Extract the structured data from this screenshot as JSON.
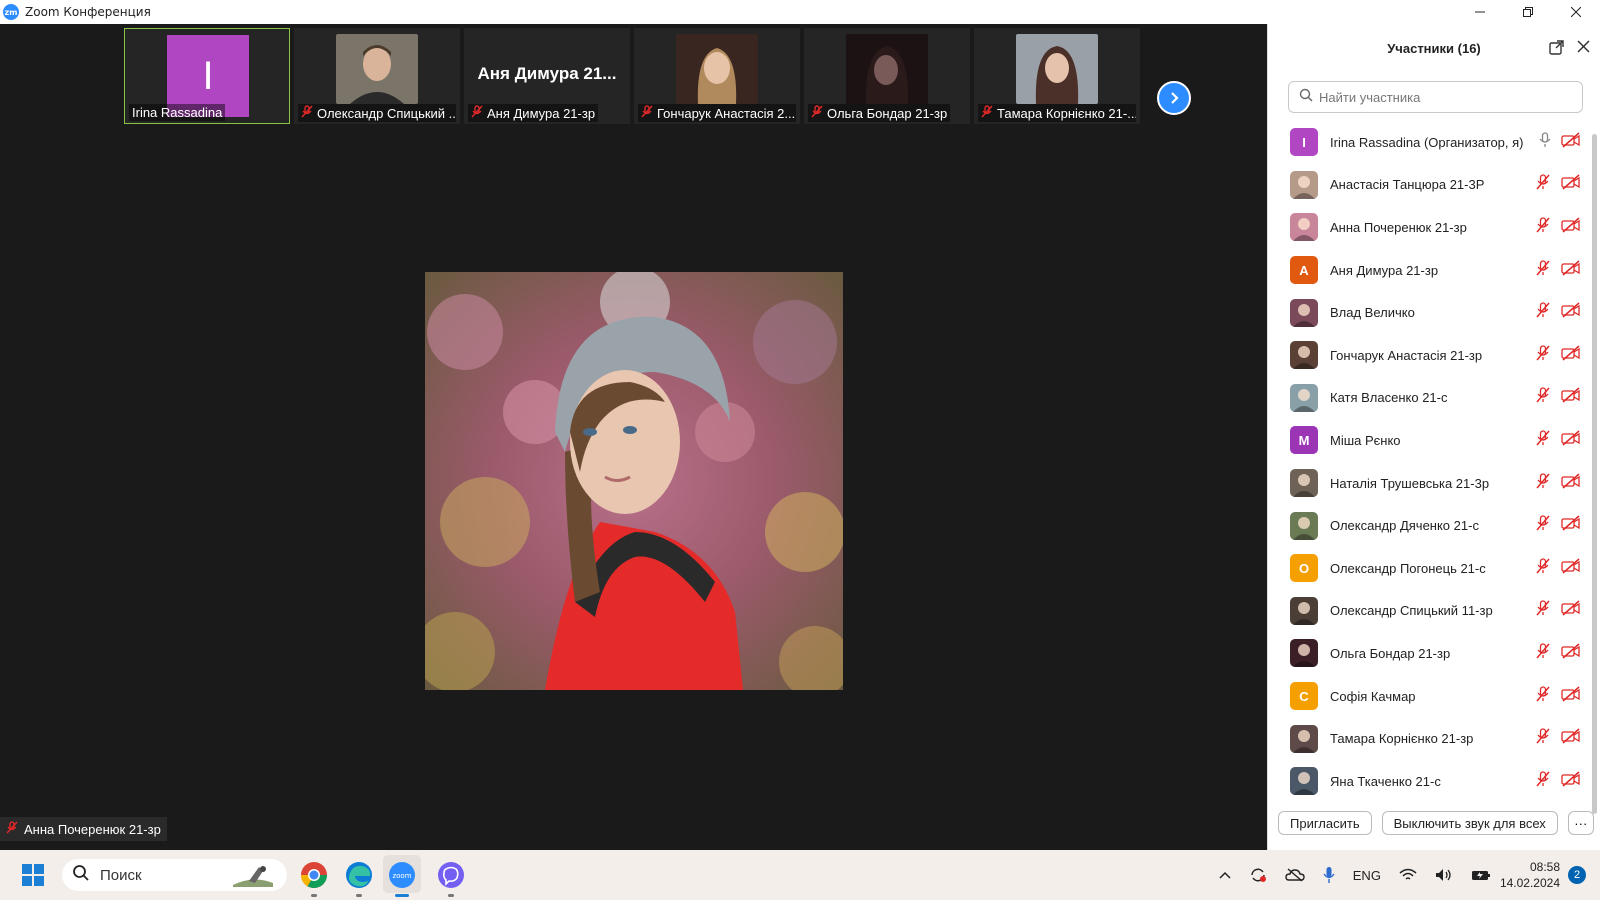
{
  "window": {
    "title": "Zoom Конференция",
    "logo": "zm"
  },
  "thumbnails": [
    {
      "name": "Irina Rassadina",
      "type": "letter",
      "letter": "I",
      "color": "#b146c2",
      "muted": false,
      "active": true
    },
    {
      "name": "Олександр Спицький ...",
      "type": "photo",
      "muted": true
    },
    {
      "name": "Аня Димура 21-зр",
      "type": "name",
      "big_name": "Аня Димура 21...",
      "muted": true
    },
    {
      "name": "Гончарук Анастасія 2...",
      "type": "photo",
      "muted": true
    },
    {
      "name": "Ольга Бондар 21-зр",
      "type": "photo",
      "muted": true
    },
    {
      "name": "Тамара Корнієнко 21-...",
      "type": "photo",
      "muted": true
    }
  ],
  "active_speaker": {
    "name": "Анна Почеренюк 21-зр",
    "muted": true
  },
  "panel": {
    "title": "Участники (16)",
    "search_placeholder": "Найти участника",
    "participants": [
      {
        "name": "Irina Rassadina (Организатор, я)",
        "avatar": "letter",
        "letter": "I",
        "color": "#b146c2",
        "mic_muted": false,
        "video_off": true
      },
      {
        "name": "Анастасія Танцюра 21-3Р",
        "avatar": "photo",
        "color": "#b59a8a",
        "mic_muted": true,
        "video_off": true
      },
      {
        "name": "Анна Почеренюк 21-зр",
        "avatar": "photo",
        "color": "#c9869b",
        "mic_muted": true,
        "video_off": true
      },
      {
        "name": "Аня Димура 21-зр",
        "avatar": "letter",
        "letter": "A",
        "color": "#e1590f",
        "mic_muted": true,
        "video_off": true
      },
      {
        "name": "Влад Величко",
        "avatar": "photo",
        "color": "#7a4a5a",
        "mic_muted": true,
        "video_off": true
      },
      {
        "name": "Гончарук Анастасія 21-зр",
        "avatar": "photo",
        "color": "#5a4035",
        "mic_muted": true,
        "video_off": true
      },
      {
        "name": "Катя Власенко 21-с",
        "avatar": "photo",
        "color": "#8aa0a8",
        "mic_muted": true,
        "video_off": true
      },
      {
        "name": "Міша Рєнко",
        "avatar": "letter",
        "letter": "M",
        "color": "#9c35b5",
        "mic_muted": true,
        "video_off": true
      },
      {
        "name": "Наталія Трушевська 21-3р",
        "avatar": "photo",
        "color": "#6e6256",
        "mic_muted": true,
        "video_off": true
      },
      {
        "name": "Олександр Дяченко 21-с",
        "avatar": "photo",
        "color": "#6a7a55",
        "mic_muted": true,
        "video_off": true
      },
      {
        "name": "Олександр Погонець 21-с",
        "avatar": "letter",
        "letter": "O",
        "color": "#f5a000",
        "mic_muted": true,
        "video_off": true
      },
      {
        "name": "Олександр Спицький 11-зр",
        "avatar": "photo",
        "color": "#4a3e36",
        "mic_muted": true,
        "video_off": true
      },
      {
        "name": "Ольга Бондар 21-зр",
        "avatar": "photo",
        "color": "#3a1f26",
        "mic_muted": true,
        "video_off": true
      },
      {
        "name": "Софія Качмар",
        "avatar": "letter",
        "letter": "C",
        "color": "#f5a000",
        "mic_muted": true,
        "video_off": true
      },
      {
        "name": "Тамара Корнієнко 21-зр",
        "avatar": "photo",
        "color": "#5e4a48",
        "mic_muted": true,
        "video_off": true
      },
      {
        "name": "Яна Ткаченко  21-с",
        "avatar": "photo",
        "color": "#4a5868",
        "mic_muted": true,
        "video_off": true
      }
    ],
    "invite_label": "Пригласить",
    "mute_all_label": "Выключить звук для всех",
    "more_label": "···"
  },
  "taskbar": {
    "search_label": "Поиск",
    "language": "ENG",
    "time": "08:58",
    "date": "14.02.2024",
    "notification_count": "2"
  }
}
